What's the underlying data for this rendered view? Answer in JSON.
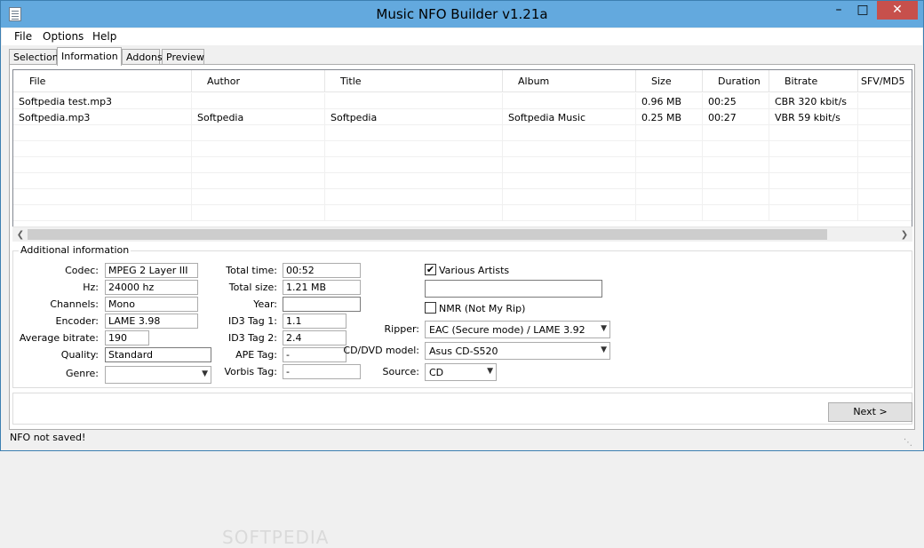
{
  "window": {
    "title": "Music NFO Builder v1.21a"
  },
  "menu": [
    "File",
    "Options",
    "Help"
  ],
  "tabs": [
    "Selection",
    "Information",
    "Addons",
    "Preview"
  ],
  "list": {
    "columns": [
      "File",
      "Author",
      "Title",
      "Album",
      "Size",
      "Duration",
      "Bitrate",
      "SFV/MD5"
    ],
    "rows": [
      [
        "Softpedia test.mp3",
        "",
        "",
        "",
        "0.96 MB",
        "00:25",
        "CBR 320 kbit/s",
        ""
      ],
      [
        "Softpedia.mp3",
        "Softpedia",
        "Softpedia",
        "Softpedia Music",
        "0.25 MB",
        "00:27",
        "VBR 59 kbit/s",
        ""
      ]
    ]
  },
  "info": {
    "legend": "Additional information",
    "codec_label": "Codec:",
    "codec": "MPEG 2 Layer III",
    "hz_label": "Hz:",
    "hz": "24000 hz",
    "channels_label": "Channels:",
    "channels": "Mono",
    "encoder_label": "Encoder:",
    "encoder": "LAME 3.98",
    "avgbitrate_label": "Average bitrate:",
    "avgbitrate": "190",
    "quality_label": "Quality:",
    "quality": "Standard",
    "genre_label": "Genre:",
    "genre": "",
    "totaltime_label": "Total time:",
    "totaltime": "00:52",
    "totalsize_label": "Total size:",
    "totalsize": "1.21 MB",
    "year_label": "Year:",
    "year": "",
    "id3tag1_label": "ID3 Tag 1:",
    "id3tag1": "1.1",
    "id3tag2_label": "ID3 Tag 2:",
    "id3tag2": "2.4",
    "apetag_label": "APE Tag:",
    "apetag": "-",
    "vorbistag_label": "Vorbis Tag:",
    "vorbistag": "-",
    "various_artists_label": "Various Artists",
    "various_artists_checked": true,
    "various_artists_value": "",
    "nmr_label": "NMR (Not My Rip)",
    "nmr_checked": false,
    "ripper_label": "Ripper:",
    "ripper": "EAC (Secure mode) / LAME 3.92",
    "cddvd_label": "CD/DVD model:",
    "cddvd": "Asus CD-S520",
    "source_label": "Source:",
    "source": "CD"
  },
  "buttons": {
    "next": "Next >"
  },
  "status": "NFO not saved!",
  "watermark": "SOFTPEDIA"
}
